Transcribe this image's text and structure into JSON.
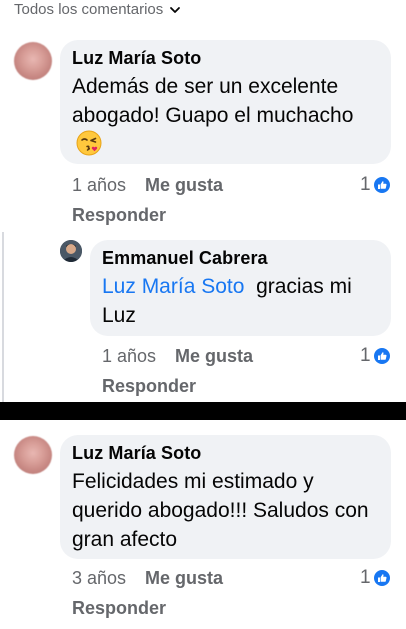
{
  "header": {
    "filter_label": "Todos los comentarios"
  },
  "colors": {
    "accent": "#1877f2",
    "bubble": "#f0f2f5",
    "muted": "#65676b"
  },
  "comments": [
    {
      "author": "Luz María Soto",
      "text": "Además de ser un excelente abogado! Guapo el muchacho",
      "emoji": "kissing-face-emoji",
      "age": "1 años",
      "like_label": "Me gusta",
      "reply_label": "Responder",
      "reaction_count": "1"
    },
    {
      "author": "Emmanuel Cabrera",
      "mention": "Luz María Soto",
      "text": "gracias mi Luz",
      "age": "1 años",
      "like_label": "Me gusta",
      "reply_label": "Responder",
      "reaction_count": "1"
    },
    {
      "author": "Luz María Soto",
      "text": "Felicidades mi estimado y querido abogado!!!  Saludos con gran afecto",
      "age": "3 años",
      "like_label": "Me gusta",
      "reply_label": "Responder",
      "reaction_count": "1"
    }
  ]
}
